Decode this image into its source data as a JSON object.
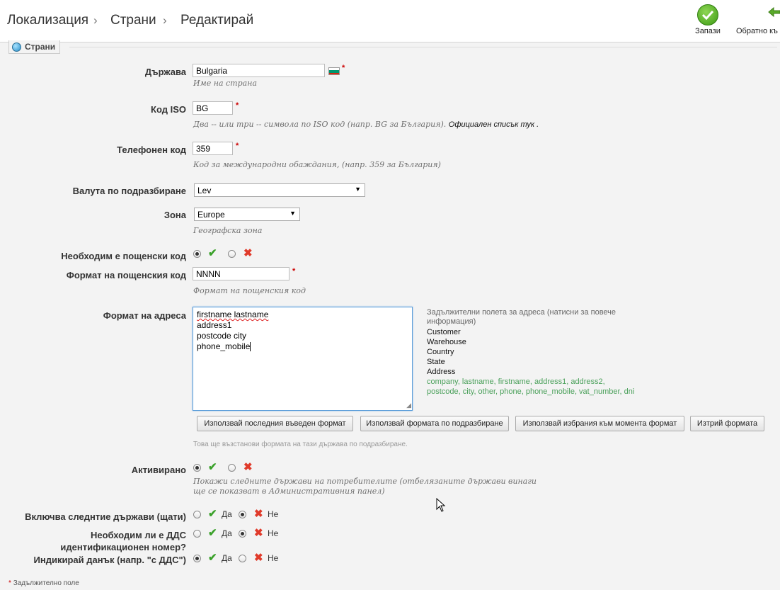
{
  "header": {
    "breadcrumbs": [
      "Локализация",
      "Страни",
      "Редактирай"
    ],
    "save_label": "Запази",
    "back_label": "Обратно къ"
  },
  "section": {
    "title": "Страни"
  },
  "form": {
    "country": {
      "label": "Държава",
      "value": "Bulgaria",
      "hint": "Име на страна"
    },
    "iso": {
      "label": "Код ISO",
      "value": "BG",
      "hint": "Два -- или три -- символа по ISO код (напр. BG за България).",
      "hint_link": "Официален списък тук ."
    },
    "phone": {
      "label": "Телефонен код",
      "value": "359",
      "hint": "Код за международни обаждания, (напр. 359 за България)"
    },
    "currency": {
      "label": "Валута по подразбиране",
      "value": "Lev"
    },
    "zone": {
      "label": "Зона",
      "value": "Europe",
      "hint": "Географска зона"
    },
    "zip_required": {
      "label": "Необходим е пощенски код",
      "selected": "yes"
    },
    "zip_format": {
      "label": "Формат на пощенския код",
      "value": "NNNN",
      "hint": "Формат на пощенския код"
    },
    "address_format": {
      "label": "Формат на адреса",
      "lines": [
        "firstname lastname",
        "address1",
        "postcode city",
        "phone_mobile"
      ],
      "side_intro_1": "Задължителни полета за адреса (натисни за повече",
      "side_intro_2": "информация)",
      "side_items": [
        "Customer",
        "Warehouse",
        "Country",
        "State",
        "Address"
      ],
      "side_fields_1": "company, lastname, firstname, address1, address2,",
      "side_fields_2": "postcode, city, other, phone, phone_mobile, vat_number, dni",
      "buttons": [
        "Използвай последния въведен формат",
        "Използвай формата по подразбиране",
        "Използвай избрания към момента формат",
        "Изтрий формата"
      ],
      "note": "Това ще възстанови формата на тази държава по подразбиране."
    },
    "active": {
      "label": "Активирано",
      "selected": "yes",
      "hint_1": "Покажи следните държави на потребителите (отбелязаните държави винаги",
      "hint_2": "ще се показват в Административния панел)"
    },
    "contains_states": {
      "label": "Включва следнтие държави (щати)",
      "yes": "Да",
      "no": "Не",
      "selected": "no"
    },
    "need_vat": {
      "label_1": "Необходим ли е ДДС",
      "label_2": "идентификационен номер?",
      "yes": "Да",
      "no": "Не",
      "selected": "no"
    },
    "display_tax": {
      "label": "Индикирай данък (напр. \"с ДДС\")",
      "yes": "Да",
      "no": "Не",
      "selected": "yes"
    },
    "required_note": "Задължително поле"
  },
  "colors": {
    "accent_green": "#3aa12a",
    "danger_red": "#e03a2a",
    "field_link_green": "#4aa05a"
  }
}
